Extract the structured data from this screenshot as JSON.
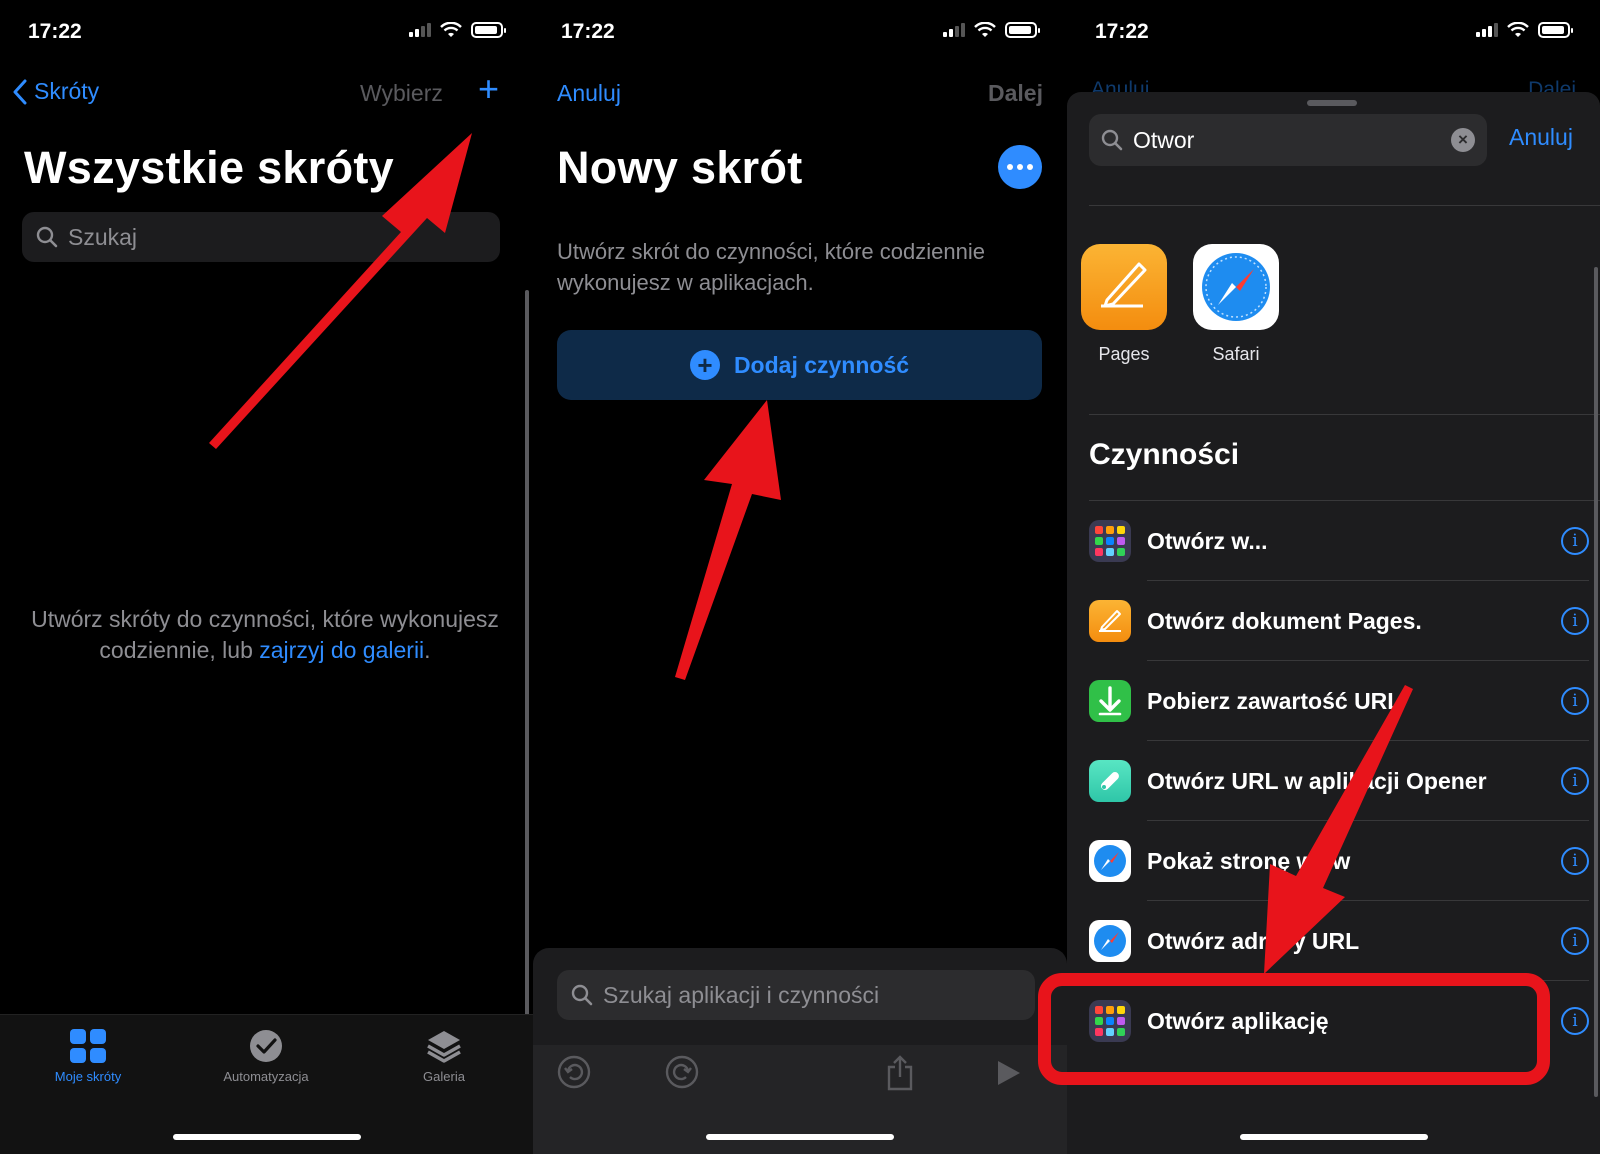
{
  "status_bar": {
    "time": "17:22"
  },
  "screen1": {
    "nav": {
      "back_label": "Skróty",
      "select_label": "Wybierz",
      "add_label": "+"
    },
    "title": "Wszystkie skróty",
    "search_placeholder": "Szukaj",
    "empty_text_1": "Utwórz skróty do czynności, które wykonujesz codziennie, lub ",
    "empty_link": "zajrzyj do galerii",
    "empty_text_2": ".",
    "tabs": [
      {
        "label": "Moje skróty",
        "icon": "grid-icon",
        "active": true
      },
      {
        "label": "Automatyzacja",
        "icon": "clock-check-icon",
        "active": false
      },
      {
        "label": "Galeria",
        "icon": "layers-icon",
        "active": false
      }
    ]
  },
  "screen2": {
    "cancel_label": "Anuluj",
    "next_label": "Dalej",
    "title": "Nowy skrót",
    "description": "Utwórz skrót do czynności, które codziennie wykonujesz w aplikacjach.",
    "add_action_label": "Dodaj czynność",
    "bottom_search_placeholder": "Szukaj aplikacji i czynności"
  },
  "screen3": {
    "search_value": "Otwor",
    "cancel_label": "Anuluj",
    "background_cancel": "Anuluj",
    "background_next": "Dalej",
    "apps": [
      {
        "label": "Pages",
        "icon": "pages-icon",
        "color": "#f7a41d"
      },
      {
        "label": "Safari",
        "icon": "safari-compass-icon",
        "color": "#1e8cf0"
      }
    ],
    "section_title": "Czynności",
    "actions": [
      {
        "label": "Otwórz w...",
        "icon": "apps-grid-icon"
      },
      {
        "label": "Otwórz dokument Pages.",
        "icon": "pages-icon"
      },
      {
        "label": "Pobierz zawartość URL",
        "icon": "download-arrow-icon"
      },
      {
        "label": "Otwórz URL w aplikacji Opener",
        "icon": "opener-icon"
      },
      {
        "label": "Pokaż stronę www",
        "icon": "safari-compass-icon"
      },
      {
        "label": "Otwórz adresy URL",
        "icon": "safari-compass-icon"
      },
      {
        "label": "Otwórz aplikację",
        "icon": "apps-grid-icon",
        "highlighted": true
      }
    ]
  },
  "colors": {
    "accent": "#2f8cff",
    "annotation": "#e8141b",
    "background": "#000000"
  }
}
